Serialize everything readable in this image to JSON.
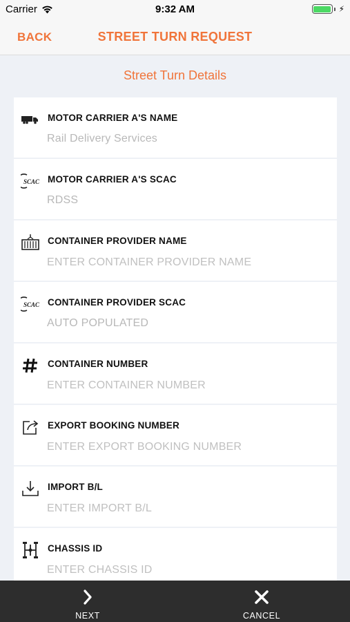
{
  "status_bar": {
    "carrier": "Carrier",
    "time": "9:32 AM"
  },
  "nav": {
    "back_label": "BACK",
    "title": "STREET TURN REQUEST"
  },
  "section": {
    "title": "Street Turn Details"
  },
  "fields": [
    {
      "icon": "truck-icon",
      "label": "MOTOR CARRIER A'S NAME",
      "value": "Rail Delivery Services",
      "placeholder": ""
    },
    {
      "icon": "scac-icon",
      "label": "MOTOR CARRIER A'S SCAC",
      "value": "RDSS",
      "placeholder": ""
    },
    {
      "icon": "container-icon",
      "label": "CONTAINER PROVIDER NAME",
      "value": "",
      "placeholder": "ENTER CONTAINER PROVIDER NAME"
    },
    {
      "icon": "scac-icon",
      "label": "CONTAINER PROVIDER SCAC",
      "value": "AUTO POPULATED",
      "placeholder": ""
    },
    {
      "icon": "hash-icon",
      "label": "CONTAINER NUMBER",
      "value": "",
      "placeholder": "ENTER CONTAINER NUMBER"
    },
    {
      "icon": "export-icon",
      "label": "EXPORT BOOKING NUMBER",
      "value": "",
      "placeholder": "ENTER EXPORT BOOKING NUMBER"
    },
    {
      "icon": "download-icon",
      "label": "IMPORT B/L",
      "value": "",
      "placeholder": "ENTER IMPORT B/L"
    },
    {
      "icon": "chassis-icon",
      "label": "CHASSIS ID",
      "value": "",
      "placeholder": "ENTER CHASSIS ID"
    }
  ],
  "scac_icon_text": "SCAC",
  "tab_bar": {
    "next_label": "NEXT",
    "cancel_label": "CANCEL"
  },
  "colors": {
    "accent": "#f0743a",
    "background": "#eef1f6",
    "tab_bar": "#2d2d2d",
    "battery": "#4cd964"
  }
}
